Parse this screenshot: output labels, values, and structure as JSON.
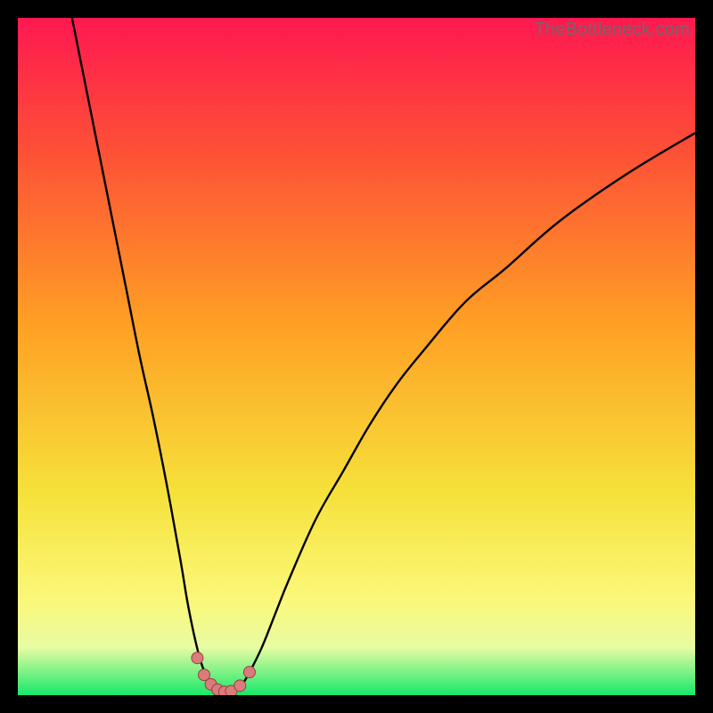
{
  "watermark": "TheBottleneck.com",
  "colors": {
    "gradient_top": "#ff1850",
    "gradient_upper_mid": "#fd5136",
    "gradient_mid": "#ff9f24",
    "gradient_lower_mid": "#f6e13a",
    "gradient_yellow_band": "#fbf87a",
    "gradient_pale": "#e7fca3",
    "gradient_bottom": "#17e86a",
    "curve": "#000000",
    "dot_fill": "#d97c7c",
    "dot_stroke": "#9a3f3f",
    "background": "#000000"
  },
  "chart_data": {
    "type": "line",
    "title": "",
    "xlabel": "",
    "ylabel": "",
    "xlim": [
      0,
      100
    ],
    "ylim": [
      0,
      100
    ],
    "note": "Bottleneck percentage curve; values sampled from the rendered shape (y = 0 is bottom green band, y = 100 is top).",
    "series": [
      {
        "name": "bottleneck-curve",
        "x": [
          8,
          10,
          12,
          14,
          16,
          18,
          20,
          22,
          24,
          25,
          26,
          27,
          28,
          29,
          30,
          31,
          32,
          33,
          34,
          36,
          38,
          40,
          44,
          48,
          52,
          56,
          60,
          66,
          72,
          80,
          90,
          100
        ],
        "values": [
          100,
          90,
          80,
          70,
          60,
          50,
          41,
          31,
          20,
          14,
          9,
          5,
          2.5,
          1.2,
          0.6,
          0.4,
          0.7,
          1.5,
          3,
          7,
          12,
          17,
          26,
          33,
          40,
          46,
          51,
          58,
          63,
          70,
          77,
          83
        ]
      }
    ],
    "points": {
      "name": "sample-dots",
      "x": [
        26.5,
        27.5,
        28.5,
        29.5,
        30.5,
        31.5,
        32.8,
        34.2
      ],
      "values": [
        5.5,
        3.0,
        1.6,
        0.8,
        0.5,
        0.6,
        1.4,
        3.4
      ]
    }
  }
}
